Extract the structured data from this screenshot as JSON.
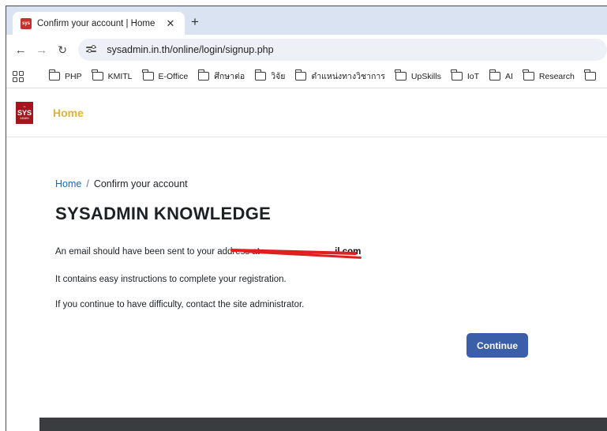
{
  "browser": {
    "tab": {
      "title": "Confirm your account | Home",
      "favicon_text": "sys"
    },
    "url": "sysadmin.in.th/online/login/signup.php",
    "bookmarks": [
      {
        "label": "PHP"
      },
      {
        "label": "KMITL"
      },
      {
        "label": "E-Office"
      },
      {
        "label": "ศึกษาต่อ"
      },
      {
        "label": "วิจัย"
      },
      {
        "label": "ตำแหน่งทางวิชาการ"
      },
      {
        "label": "UpSkills"
      },
      {
        "label": "IoT"
      },
      {
        "label": "AI"
      },
      {
        "label": "Research"
      }
    ]
  },
  "site": {
    "logo": {
      "top": "⌁",
      "mid": "SYS",
      "bot": "ADMIN"
    },
    "home_link": "Home"
  },
  "main": {
    "breadcrumb": {
      "home": "Home",
      "separator": "/",
      "current": "Confirm your account"
    },
    "title": "SYSADMIN KNOWLEDGE",
    "line1_prefix": "An email should have been sent to your address at",
    "line1_email_visible": "il.com",
    "line2": "It contains easy instructions to complete your registration.",
    "line3": "If you continue to have difficulty, contact the site administrator.",
    "continue_label": "Continue"
  },
  "colors": {
    "accent_button": "#3b5ea8",
    "home_link": "#e0b338",
    "logo_bg": "#a3161e",
    "link": "#0f6cbf",
    "redaction": "#e02020"
  }
}
